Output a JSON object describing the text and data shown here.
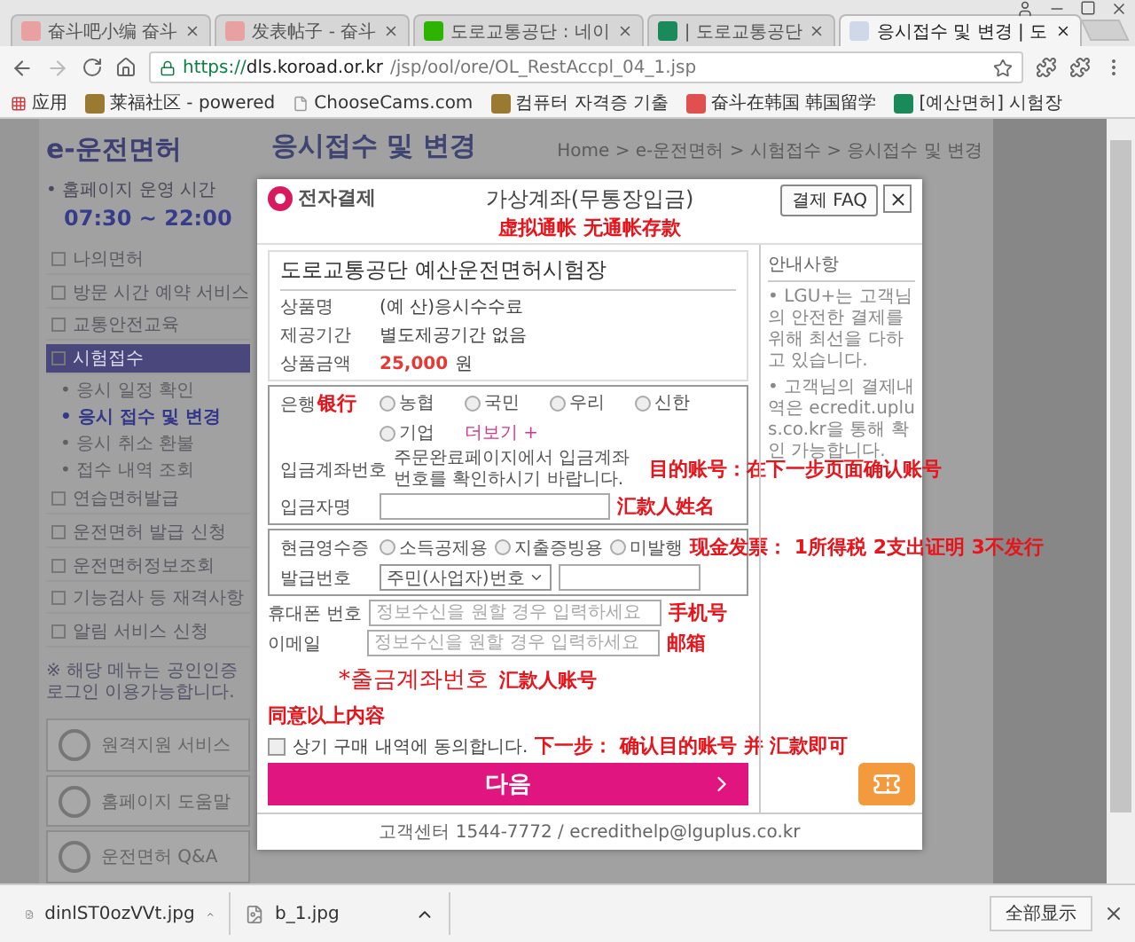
{
  "browser": {
    "tabs": [
      {
        "title": "奋斗吧小编 奋斗",
        "selected": false,
        "kind": "forum"
      },
      {
        "title": "发表帖子 - 奋斗",
        "selected": false,
        "kind": "forum"
      },
      {
        "title": "도로교통공단 : 네이",
        "selected": false,
        "kind": "naver"
      },
      {
        "title": "| 도로교통공단",
        "selected": false,
        "kind": "koroad"
      },
      {
        "title": "응시접수 및 변경 | 도",
        "selected": true,
        "kind": "page"
      }
    ],
    "url": {
      "scheme": "https://",
      "host": "dls.koroad.or.kr",
      "path": "/jsp/ool/ore/OL_RestAccpl_04_1.jsp"
    },
    "bookmarks": [
      {
        "label": "应用",
        "kind": "apps"
      },
      {
        "label": "莱福社区 - powered",
        "kind": "site"
      },
      {
        "label": "ChooseCams.com",
        "kind": "page"
      },
      {
        "label": "컴퓨터 자격증 기출",
        "kind": "site"
      },
      {
        "label": "奋斗在韩国 韩国留学",
        "kind": "forum"
      },
      {
        "label": "[예산면허] 시험장",
        "kind": "koroad"
      }
    ]
  },
  "site": {
    "logo": "e-운전면허",
    "hours_label": "• 홈페이지 운영 시간",
    "hours": "07:30 ~ 22:00",
    "menu": [
      {
        "label": "나의면허",
        "selected": false
      },
      {
        "label": "방문 시간 예약 서비스",
        "selected": false
      },
      {
        "label": "교통안전교육",
        "selected": false
      },
      {
        "label": "시험접수",
        "selected": true,
        "children": [
          {
            "label": "• 응시 일정 확인",
            "selected": false
          },
          {
            "label": "• 응시 접수 및 변경",
            "selected": true
          },
          {
            "label": "• 응시 취소 환불",
            "selected": false
          },
          {
            "label": "• 접수 내역 조회",
            "selected": false
          }
        ]
      },
      {
        "label": "연습면허발급",
        "selected": false
      },
      {
        "label": "운전면허 발급 신청",
        "selected": false
      },
      {
        "label": "운전면허정보조회",
        "selected": false
      },
      {
        "label": "기능검사 등 재격사항",
        "selected": false
      },
      {
        "label": "알림 서비스 신청",
        "selected": false
      }
    ],
    "notice": "※ 해당 메뉴는 공인인증 로그인 이용가능합니다.",
    "quick_links": [
      "원격지원 서비스",
      "홈페이지 도움말",
      "운전면허 Q&A"
    ],
    "title": "응시접수 및 변경",
    "breadcrumb": "Home > e-운전면허 > 시험접수 > 응시접수 및 변경"
  },
  "dialog": {
    "brand": "전자결제",
    "title": "가상계좌(무통장입금)",
    "title_note": "虚拟通帐 无通帐存款",
    "faq_button": "결제 FAQ",
    "merchant": "도로교통공단 예산운전면허시험장",
    "product_rows": [
      {
        "label": "상품명",
        "value": "(예 산)응시수수료",
        "kind": "text"
      },
      {
        "label": "제공기간",
        "value": "별도제공기간 없음",
        "kind": "text"
      },
      {
        "label": "상품금액",
        "value": "25,000",
        "unit": "원",
        "kind": "price"
      }
    ],
    "bank": {
      "label": "은행",
      "note": "银行",
      "options": [
        {
          "label": "농협",
          "selected": false
        },
        {
          "label": "국민",
          "selected": false
        },
        {
          "label": "우리",
          "selected": false
        },
        {
          "label": "신한",
          "selected": false
        },
        {
          "label": "기업",
          "selected": false
        }
      ],
      "more": "더보기 +",
      "account_label": "입금계좌번호",
      "account_text": "주문완료페이지에서 입금계좌번호를 확인하시기 바랍니다.",
      "account_note": "目的账号：在下一步页面确认账号",
      "name_label": "입금자명",
      "name_note": "汇款人姓名"
    },
    "receipt": {
      "label": "현금영수증",
      "options": [
        {
          "label": "소득공제용",
          "selected": false
        },
        {
          "label": "지출증빙용",
          "selected": false
        },
        {
          "label": "미발행",
          "selected": false
        }
      ],
      "note": "现金发票： 1所得税 2支出证明 3不发行",
      "number_label": "발급번호",
      "number_type": "주민(사업자)번호"
    },
    "contact": [
      {
        "label": "휴대폰 번호",
        "placeholder": "정보수신을 원할 경우 입력하세요",
        "note": "手机号"
      },
      {
        "label": "이메일",
        "placeholder": "정보수신을 원할 경우 입력하세요",
        "note": "邮箱"
      }
    ],
    "withdraw_label": "*출금계좌번호",
    "withdraw_note": "汇款人账号",
    "agree_note": "同意以上内容",
    "agree": {
      "label": "상기 구매 내역에 동의합니다.",
      "checked": false
    },
    "next_note": "下一步： 确认目的账号 并 汇款即可",
    "next_button": "다음",
    "info_title": "안내사항",
    "info_items": [
      "• LGU+는 고객님의 안전한 결제를 위해 최선을 다하고 있습니다.",
      "• 고객님의 결제내역은 ecredit.uplus.co.kr을 통해 확인 가능합니다."
    ],
    "footer": "고객센터 1544-7772 / ecredithelp@lguplus.co.kr"
  },
  "downloads": {
    "files": [
      "dinlST0ozVVt.jpg",
      "b_1.jpg"
    ],
    "show_all": "全部显示"
  }
}
